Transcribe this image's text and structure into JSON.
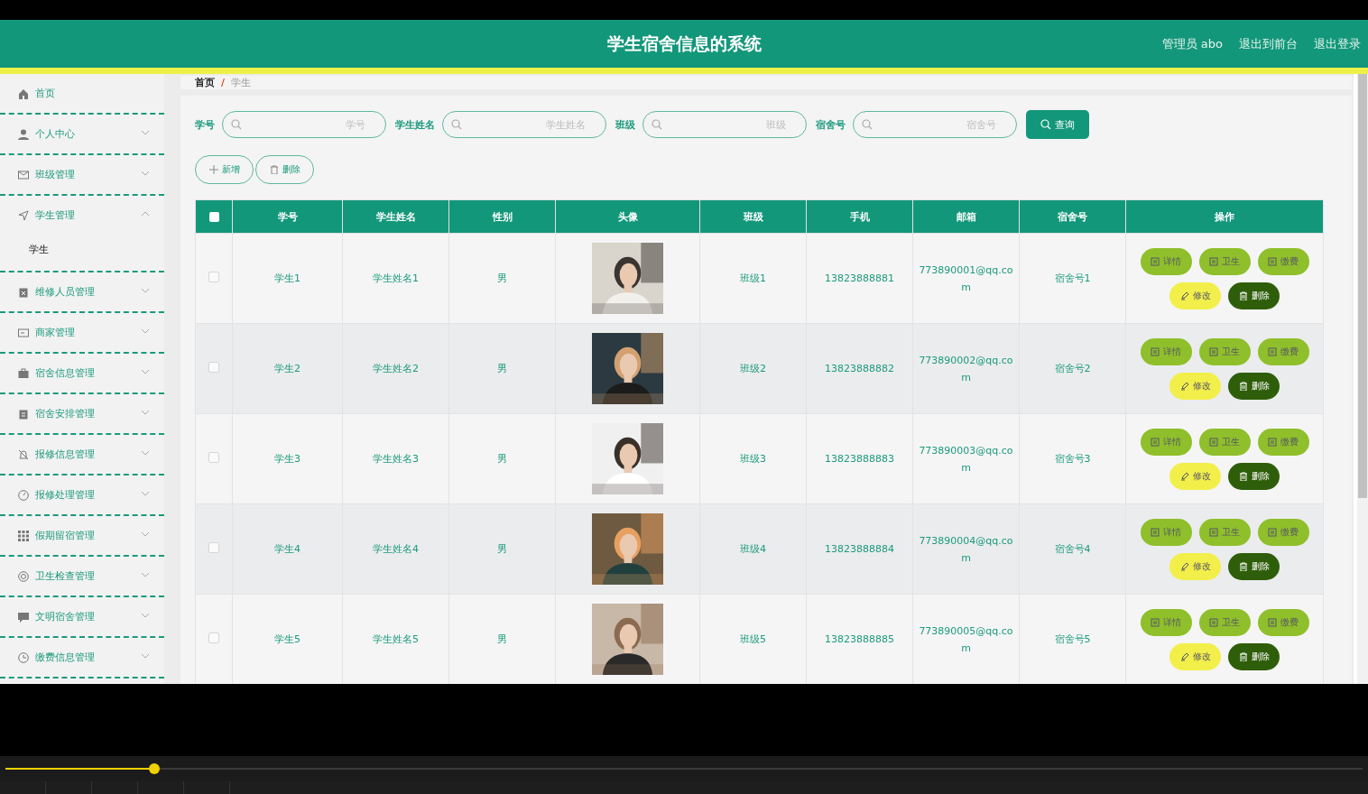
{
  "header": {
    "title": "学生宿舍信息的系统",
    "user": "管理员 abo",
    "links": [
      "退出到前台",
      "退出登录"
    ]
  },
  "sidebar": {
    "items": [
      {
        "label": "首页"
      },
      {
        "label": "个人中心",
        "expanded": false
      },
      {
        "label": "班级管理",
        "expanded": false
      },
      {
        "label": "学生管理",
        "expanded": true,
        "children": [
          {
            "label": "学生"
          }
        ]
      },
      {
        "label": "维修人员管理",
        "expanded": false
      },
      {
        "label": "商家管理",
        "expanded": false
      },
      {
        "label": "宿舍信息管理",
        "expanded": false
      },
      {
        "label": "宿舍安排管理",
        "expanded": false
      },
      {
        "label": "报修信息管理",
        "expanded": false
      },
      {
        "label": "报修处理管理",
        "expanded": false
      },
      {
        "label": "假期留宿管理",
        "expanded": false
      },
      {
        "label": "卫生检查管理",
        "expanded": false
      },
      {
        "label": "文明宿舍管理",
        "expanded": false
      },
      {
        "label": "缴费信息管理",
        "expanded": false
      }
    ]
  },
  "breadcrumb": [
    "首页",
    "学生"
  ],
  "breadcrumb_separator": "/",
  "search": {
    "fields": [
      {
        "label": "学号",
        "placeholder": "学号"
      },
      {
        "label": "学生姓名",
        "placeholder": "学生姓名"
      },
      {
        "label": "班级",
        "placeholder": "班级"
      },
      {
        "label": "宿舍号",
        "placeholder": "宿舍号"
      }
    ],
    "button": "查询"
  },
  "toolbar": [
    {
      "label": "新增",
      "kind": "add"
    },
    {
      "label": "删除",
      "kind": "delete"
    }
  ],
  "table": {
    "select_all": {
      "checked": false
    },
    "columns": [
      "学号",
      "学生姓名",
      "性别",
      "头像",
      "班级",
      "手机",
      "邮箱",
      "宿舍号",
      "操作"
    ],
    "rows": [
      {
        "checked": false,
        "cells": [
          "学生1",
          "学生姓名1",
          "男",
          "",
          "班级1",
          "13823888881",
          "773890001@qq.com",
          "宿舍号1"
        ],
        "avatar": {
          "kind": "picture"
        },
        "actions": [
          {
            "label": "详情",
            "kind": "info"
          },
          {
            "label": "卫生",
            "kind": "info"
          },
          {
            "label": "缴费",
            "kind": "info"
          },
          {
            "label": "修改",
            "kind": "edit"
          },
          {
            "label": "删除",
            "kind": "delete"
          }
        ]
      },
      {
        "checked": false,
        "cells": [
          "学生2",
          "学生姓名2",
          "男",
          "",
          "班级2",
          "13823888882",
          "773890002@qq.com",
          "宿舍号2"
        ],
        "avatar": {
          "kind": "picture"
        },
        "actions": [
          {
            "label": "详情",
            "kind": "info"
          },
          {
            "label": "卫生",
            "kind": "info"
          },
          {
            "label": "缴费",
            "kind": "info"
          },
          {
            "label": "修改",
            "kind": "edit"
          },
          {
            "label": "删除",
            "kind": "delete"
          }
        ]
      },
      {
        "checked": false,
        "cells": [
          "学生3",
          "学生姓名3",
          "男",
          "",
          "班级3",
          "13823888883",
          "773890003@qq.com",
          "宿舍号3"
        ],
        "avatar": {
          "kind": "picture"
        },
        "actions": [
          {
            "label": "详情",
            "kind": "info"
          },
          {
            "label": "卫生",
            "kind": "info"
          },
          {
            "label": "缴费",
            "kind": "info"
          },
          {
            "label": "修改",
            "kind": "edit"
          },
          {
            "label": "删除",
            "kind": "delete"
          }
        ]
      },
      {
        "checked": false,
        "cells": [
          "学生4",
          "学生姓名4",
          "男",
          "",
          "班级4",
          "13823888884",
          "773890004@qq.com",
          "宿舍号4"
        ],
        "avatar": {
          "kind": "picture"
        },
        "actions": [
          {
            "label": "详情",
            "kind": "info"
          },
          {
            "label": "卫生",
            "kind": "info"
          },
          {
            "label": "缴费",
            "kind": "info"
          },
          {
            "label": "修改",
            "kind": "edit"
          },
          {
            "label": "删除",
            "kind": "delete"
          }
        ]
      },
      {
        "checked": false,
        "cells": [
          "学生5",
          "学生姓名5",
          "男",
          "",
          "班级5",
          "13823888885",
          "773890005@qq.com",
          "宿舍号5"
        ],
        "avatar": {
          "kind": "picture"
        },
        "actions": [
          {
            "label": "详情",
            "kind": "info"
          },
          {
            "label": "卫生",
            "kind": "info"
          },
          {
            "label": "缴费",
            "kind": "info"
          },
          {
            "label": "修改",
            "kind": "edit"
          },
          {
            "label": "删除",
            "kind": "delete"
          }
        ]
      }
    ]
  },
  "player": {
    "level": 0.11
  }
}
